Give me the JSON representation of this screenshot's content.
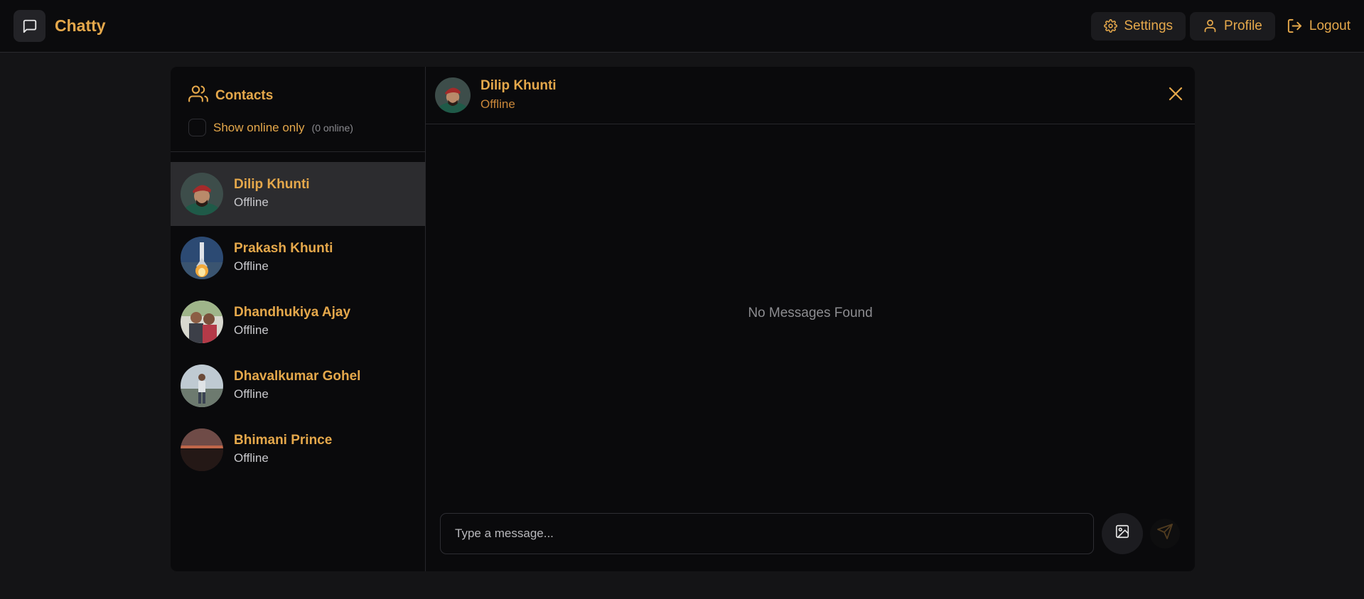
{
  "app": {
    "name": "Chatty"
  },
  "nav": {
    "settings": "Settings",
    "profile": "Profile",
    "logout": "Logout"
  },
  "sidebar": {
    "title": "Contacts",
    "online_filter_label": "Show online only",
    "online_count": "(0 online)",
    "contacts": [
      {
        "name": "Dilip Khunti",
        "status": "Offline",
        "active": true
      },
      {
        "name": "Prakash Khunti",
        "status": "Offline"
      },
      {
        "name": "Dhandhukiya Ajay",
        "status": "Offline"
      },
      {
        "name": "Dhavalkumar Gohel",
        "status": "Offline"
      },
      {
        "name": "Bhimani Prince",
        "status": "Offline"
      }
    ]
  },
  "chat": {
    "name": "Dilip Khunti",
    "status": "Offline",
    "empty_text": "No Messages Found",
    "input_placeholder": "Type a message..."
  },
  "colors": {
    "accent": "#e5a84b",
    "background": "#141416",
    "panel": "#0a0a0c",
    "active_row": "#2c2c2f"
  }
}
